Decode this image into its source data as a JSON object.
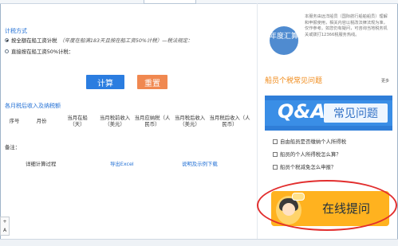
{
  "left": {
    "calc_mode_title": "计税方式",
    "options": [
      {
        "label": "按全额在船工资计税",
        "note": "（年度在船满183天且按在船工资50%计税）—税法规定：",
        "selected": true
      },
      {
        "label": "直接按在船工资50%计税：",
        "selected": false
      }
    ],
    "buttons": {
      "calculate": "计算",
      "reset": "重置"
    },
    "monthly_title": "各月税后收入及纳税额",
    "table_headers": [
      "序号",
      "月份",
      "当月在船（天）",
      "当月税前收入（美元）",
      "当月应纳税（人民币）",
      "当月税后收入（美元）",
      "当月税后收入（人民币）"
    ],
    "remark": "备注：",
    "links": {
      "detail": "详细计算过程",
      "export": "导出Excel",
      "example": "说明及示例下载"
    },
    "side_control": "+ A"
  },
  "right": {
    "badge_text": "年度汇算",
    "intro": "本服务由远洋船员（国际航行船舶船员）理解和申报使用，相关内容以税改法律法规为准，仅作参考。如您仍有疑问，可咨询当地税务机关或拨打12366税服务热线。",
    "faq": {
      "title": "船员个税常见问题",
      "more": "更多",
      "banner_text": "常见问题",
      "items": [
        "自由船员是否缴纳个人所得税",
        "船员的个人所得税怎么算？",
        "船员个税减免怎么申报？"
      ]
    },
    "online": {
      "label": "在线提问"
    }
  },
  "colors": {
    "accent_blue": "#2b7de0",
    "reset_orange": "#f08850",
    "faq_orange": "#f08a18",
    "highlight_red": "#e22e2e"
  }
}
